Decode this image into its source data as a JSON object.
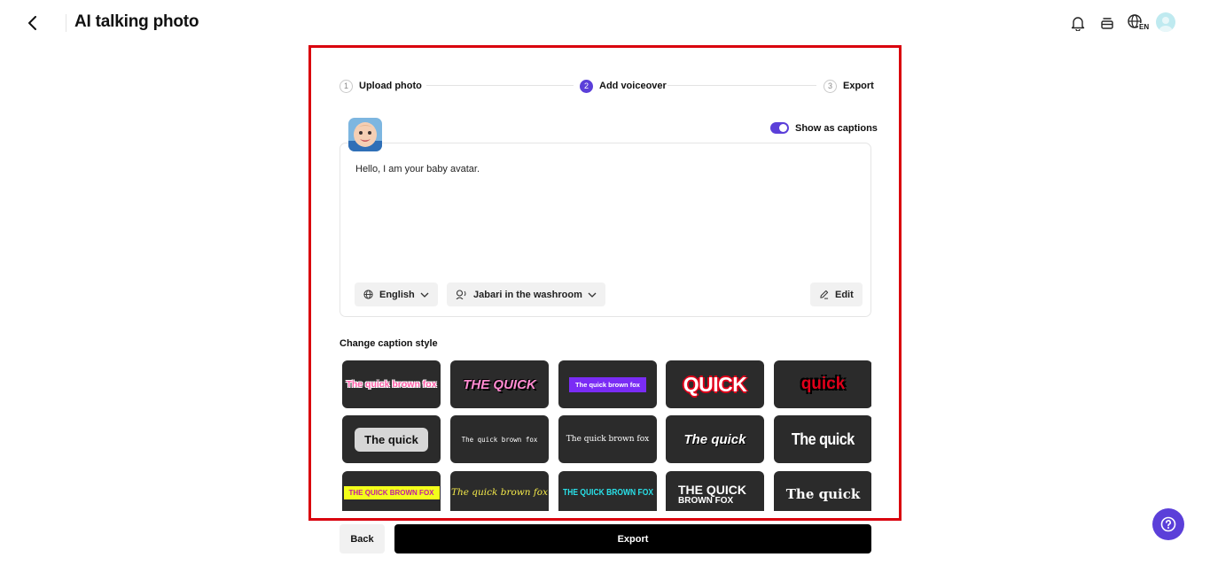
{
  "header": {
    "title": "AI talking photo",
    "language_badge": "EN",
    "icons": [
      "back-arrow-icon",
      "bell-icon",
      "card-stack-icon",
      "globe-language-icon",
      "user-avatar"
    ]
  },
  "stepper": {
    "steps": [
      {
        "num": "1",
        "label": "Upload photo",
        "state": "done"
      },
      {
        "num": "2",
        "label": "Add voiceover",
        "state": "active"
      },
      {
        "num": "3",
        "label": "Export",
        "state": "pending"
      }
    ]
  },
  "captions_toggle": {
    "label": "Show as captions",
    "on": true
  },
  "script": {
    "text": "Hello, I am your baby avatar.",
    "language": "English",
    "voice": "Jabari in the washroom",
    "edit_label": "Edit"
  },
  "caption_style": {
    "title": "Change caption style",
    "tiles": [
      "The quick brown fox",
      "THE QUICK",
      "The quick brown fox",
      "QUICK",
      "quick",
      "The quick",
      "The quick brown fox",
      "The quick brown fox",
      "The quick",
      "The quick",
      "THE QUICK BROWN FOX",
      "The quick brown fox",
      "THE QUICK BROWN FOX",
      "THE QUICK",
      "The quick"
    ],
    "tile_14_sub": "BROWN FOX"
  },
  "footer": {
    "back_label": "Back",
    "export_label": "Export"
  },
  "colors": {
    "accent": "#5b3fd9",
    "highlight": "#d9000d",
    "tile_bg": "#2b2b2b"
  }
}
